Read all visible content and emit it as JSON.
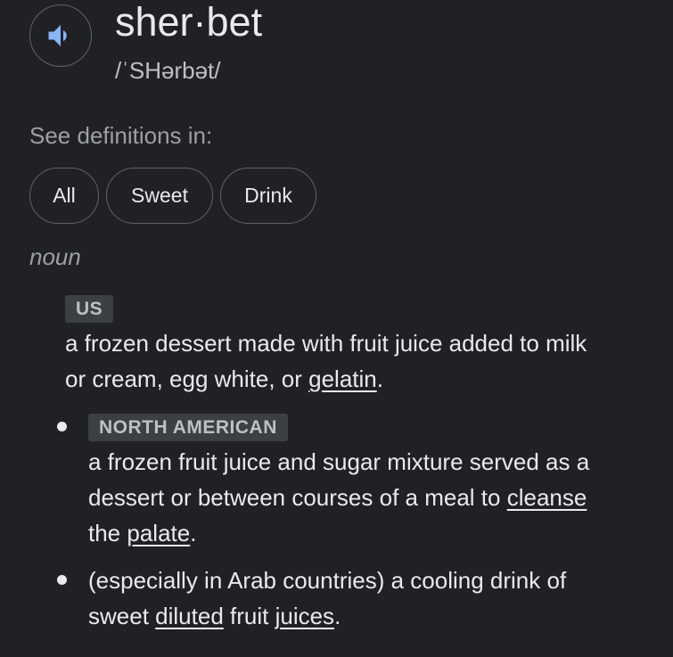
{
  "header": {
    "word": "sher·bet",
    "phonetic": "/ˈSHərbət/"
  },
  "filters": {
    "heading": "See definitions in:",
    "chips": [
      "All",
      "Sweet",
      "Drink"
    ]
  },
  "part_of_speech": "noun",
  "senses": [
    {
      "label": "US",
      "line1": "a frozen dessert made with fruit juice added to milk",
      "line2_pre": "or cream, egg white, or ",
      "line2_link": "gelatin",
      "line2_post": "."
    },
    {
      "label": "NORTH AMERICAN",
      "line1": "a frozen fruit juice and sugar mixture served as a",
      "line2_pre": "dessert or between courses of a meal to ",
      "line2_link": "cleanse",
      "line3_pre": "the ",
      "line3_link": "palate",
      "line3_post": "."
    },
    {
      "line1": "(especially in Arab countries) a cooling drink of",
      "line2_pre": "sweet ",
      "line2_link1": "diluted",
      "line2_mid": " fruit ",
      "line2_link2": "juices",
      "line2_post": "."
    }
  ],
  "icons": {
    "speaker": "speaker-volume-icon",
    "bullet": "bullet-dot"
  },
  "colors": {
    "background": "#202124",
    "text": "#e8eaed",
    "muted": "#9aa0a6",
    "speaker_icon": "#8ab4f8",
    "label_bg": "#3c4043"
  }
}
